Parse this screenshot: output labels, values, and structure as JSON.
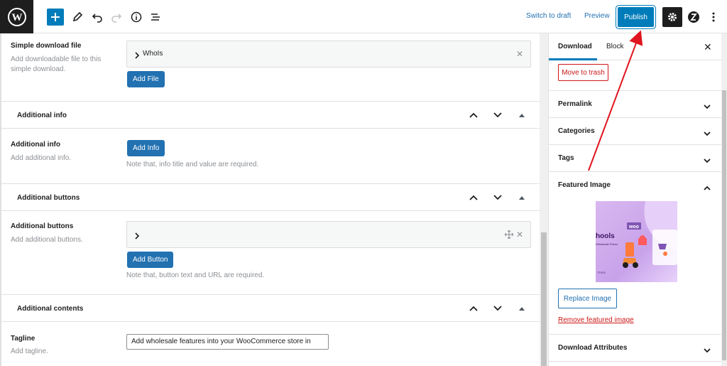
{
  "toolbar": {
    "switch_to_draft": "Switch to draft",
    "preview": "Preview",
    "publish": "Publish"
  },
  "main": {
    "simple_download": {
      "label": "Simple download file",
      "desc": "Add downloadable file to this simple download.",
      "item": "WhoIs",
      "button": "Add File"
    },
    "additional_info_section": "Additional info",
    "additional_info": {
      "label": "Additional info",
      "desc": "Add additional info.",
      "button": "Add Info",
      "note": "Note that, info title and value are required."
    },
    "additional_buttons_section": "Additional buttons",
    "additional_buttons": {
      "label": "Additional buttons",
      "desc": "Add additional buttons.",
      "button": "Add Button",
      "note": "Note that, button text and URL are required."
    },
    "additional_contents_section": "Additional contents",
    "tagline": {
      "label": "Tagline",
      "desc": "Add tagline.",
      "value": "Add wholesale features into your WooCommerce store in"
    }
  },
  "sidebar": {
    "tabs": [
      "Download",
      "Block"
    ],
    "move_to_trash": "Move to trash",
    "panels": [
      "Permalink",
      "Categories",
      "Tags",
      "Featured Image"
    ],
    "featured_image_texts": {
      "brand": "woo",
      "title": "hools",
      "sub": "Wholesale Prices",
      "foot": "TTIOS"
    },
    "replace_image": "Replace Image",
    "remove_image": "Remove featured image",
    "download_attributes": "Download Attributes"
  },
  "colors": {
    "accent": "#007cba",
    "button_blue": "#2271b1",
    "danger": "#cc1818",
    "arrow": "#e0141e"
  }
}
